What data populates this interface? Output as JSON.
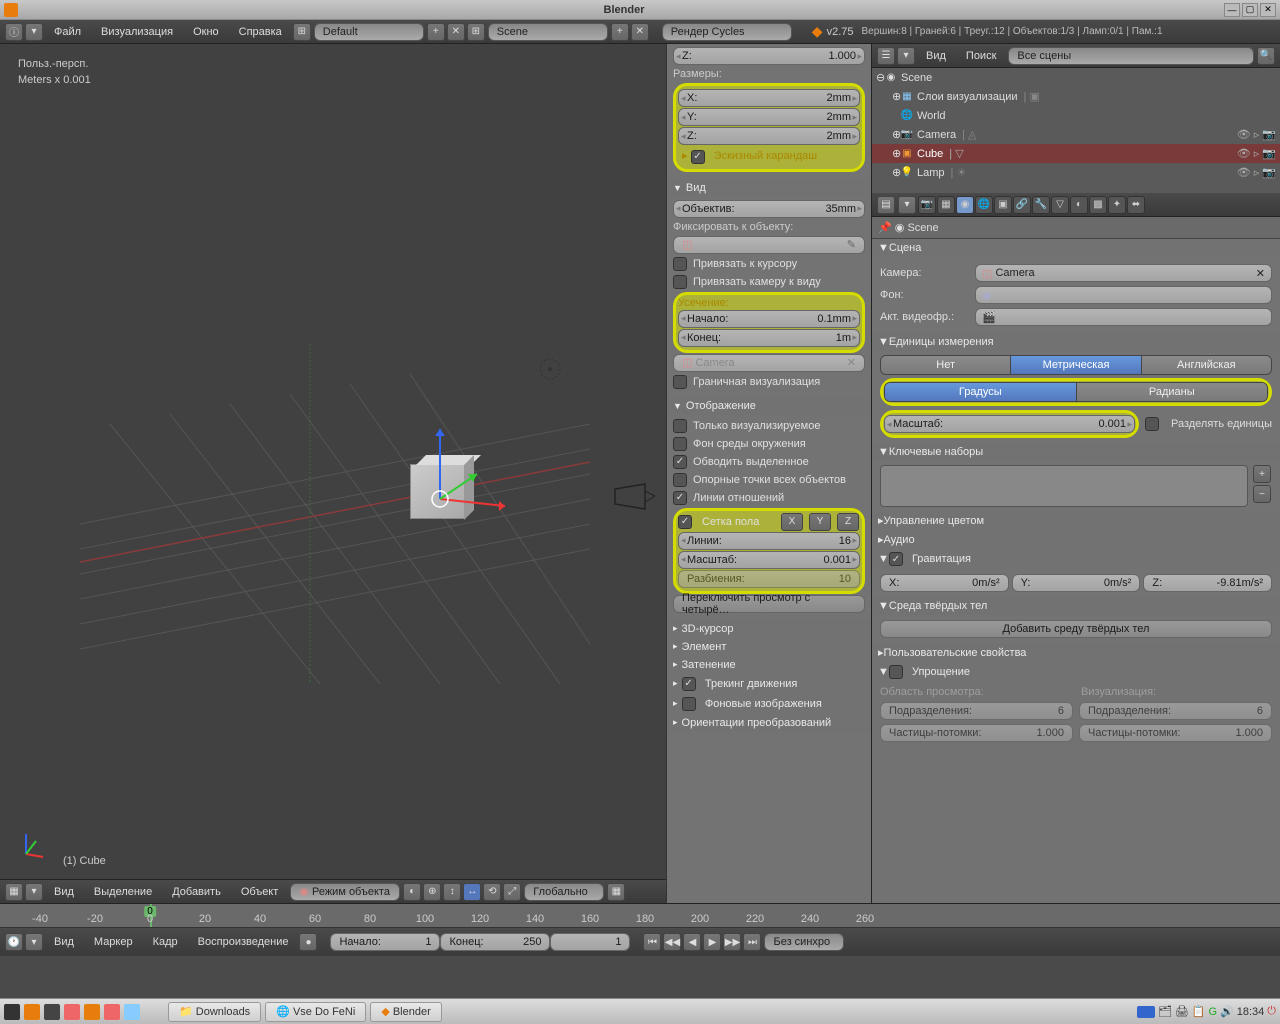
{
  "titlebar": {
    "title": "Blender"
  },
  "topmenu": {
    "file": "Файл",
    "render": "Визуализация",
    "window": "Окно",
    "help": "Справка",
    "layout": "Default",
    "scene": "Scene",
    "engine": "Рендер Cycles",
    "version": "v2.75",
    "stats": "Вершин:8 | Граней:6 | Треуг.:12 | Объектов:1/3 | Ламп:0/1 | Пам.:1"
  },
  "viewport": {
    "persp": "Польз.-персп.",
    "units": "Meters x 0.001",
    "object": "(1) Cube"
  },
  "vp_bottombar": {
    "view": "Вид",
    "select": "Выделение",
    "add": "Добавить",
    "object": "Объект",
    "mode": "Режим объекта",
    "orientation": "Глобально"
  },
  "npanel": {
    "z_top": {
      "label": "Z:",
      "value": "1.000"
    },
    "dimensions_header": "Размеры:",
    "dim_x": {
      "label": "X:",
      "value": "2mm"
    },
    "dim_y": {
      "label": "Y:",
      "value": "2mm"
    },
    "dim_z": {
      "label": "Z:",
      "value": "2mm"
    },
    "greasepencil": "Эскизный карандаш",
    "view_header": "Вид",
    "lens": {
      "label": "Объектив:",
      "value": "35mm"
    },
    "lock_obj_label": "Фиксировать к объекту:",
    "lock_cursor": "Привязать к курсору",
    "lock_camera": "Привязать камеру к виду",
    "clip_header": "Усечение:",
    "clip_start": {
      "label": "Начало:",
      "value": "0.1mm"
    },
    "clip_end": {
      "label": "Конец:",
      "value": "1m"
    },
    "camera_field": "Camera",
    "bound_viz": "Граничная визуализация",
    "display_header": "Отображение",
    "only_render": "Только визуализируемое",
    "world_bg": "Фон среды окружения",
    "outline_sel": "Обводить выделенное",
    "all_origins": "Опорные точки всех объектов",
    "relationship": "Линии отношений",
    "grid_floor": "Сетка пола",
    "grid_x": "X",
    "grid_y": "Y",
    "grid_z": "Z",
    "lines": {
      "label": "Линии:",
      "value": "16"
    },
    "scale": {
      "label": "Масштаб:",
      "value": "0.001"
    },
    "subdiv": {
      "label": "Разбиения:",
      "value": "10"
    },
    "toggle_quad": "Переключить просмотр с четырё…",
    "cursor3d": "3D-курсор",
    "element": "Элемент",
    "shading": "Затенение",
    "motion_track": "Трекинг движения",
    "bg_images": "Фоновые изображения",
    "transform_orient": "Ориентации преобразований"
  },
  "outliner_header": {
    "view": "Вид",
    "search": "Поиск",
    "filter": "Все сцены"
  },
  "outliner": {
    "scene": "Scene",
    "renderlayers": "Слои визуализации",
    "world": "World",
    "camera": "Camera",
    "cube": "Cube",
    "lamp": "Lamp"
  },
  "props": {
    "breadcrumb": "Scene",
    "scene_header": "Сцена",
    "camera_label": "Камера:",
    "camera_value": "Camera",
    "bg_label": "Фон:",
    "active_clip_label": "Акт. видеофр.:",
    "units_header": "Единицы измерения",
    "unit_none": "Нет",
    "unit_metric": "Метрическая",
    "unit_imperial": "Английская",
    "degrees": "Градусы",
    "radians": "Радианы",
    "scale": {
      "label": "Масштаб:",
      "value": "0.001"
    },
    "separate": "Разделять единицы",
    "keysets_header": "Ключевые наборы",
    "color_mgmt": "Управление цветом",
    "audio": "Аудио",
    "gravity_header": "Гравитация",
    "grav_x": {
      "label": "X:",
      "value": "0m/s²"
    },
    "grav_y": {
      "label": "Y:",
      "value": "0m/s²"
    },
    "grav_z": {
      "label": "Z:",
      "value": "-9.81m/s²"
    },
    "rigidbody_header": "Среда твёрдых тел",
    "add_rigidbody": "Добавить среду твёрдых тел",
    "custom_props": "Пользовательские свойства",
    "simplify_header": "Упрощение",
    "simplify_viewport": "Область просмотра:",
    "simplify_render": "Визуализация:",
    "subdiv_label": "Подразделения:",
    "subdiv_val": "6",
    "particles_label": "Частицы-потомки:",
    "particles_val": "1.000"
  },
  "timeline": {
    "ticks": [
      "-40",
      "-20",
      "0",
      "20",
      "40",
      "60",
      "80",
      "100",
      "120",
      "140",
      "160",
      "180",
      "200",
      "220",
      "240",
      "260"
    ],
    "current": "0",
    "view": "Вид",
    "marker": "Маркер",
    "frame": "Кадр",
    "playback": "Воспроизведение",
    "start": {
      "label": "Начало:",
      "value": "1"
    },
    "end": {
      "label": "Конец:",
      "value": "250"
    },
    "frame_field": "1",
    "nosync": "Без синхро"
  },
  "taskbar": {
    "downloads": "Downloads",
    "vse": "Vse Do FeNi",
    "blender": "Blender",
    "time": "18:34"
  }
}
